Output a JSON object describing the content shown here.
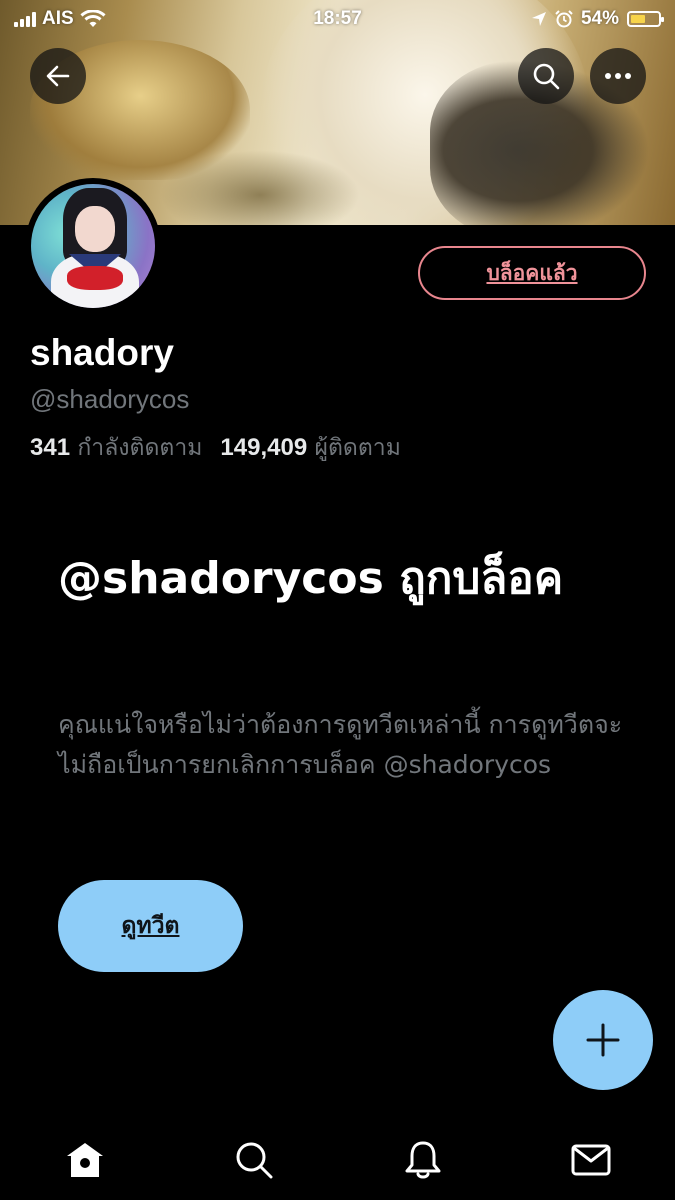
{
  "status_bar": {
    "carrier": "AIS",
    "time": "18:57",
    "battery_percent": "54%",
    "battery_level": 0.54,
    "icons": [
      "signal-icon",
      "wifi-icon",
      "location-icon",
      "alarm-icon",
      "battery-icon"
    ]
  },
  "header": {
    "back_icon": "back-arrow-icon",
    "search_icon": "search-icon",
    "more_icon": "more-icon"
  },
  "profile": {
    "display_name": "shadory",
    "handle": "@shadorycos",
    "following_count": "341",
    "following_label": "กำลังติดตาม",
    "followers_count": "149,409",
    "followers_label": "ผู้ติดตาม",
    "blocked_button_label": "บล็อคแล้ว"
  },
  "blocked_notice": {
    "title": "@shadorycos ถูกบล็อค",
    "description": "คุณแน่ใจหรือไม่ว่าต้องการดูทวีตเหล่านี้ การดูทวีตจะไม่ถือเป็นการยกเลิกการบล็อค @shadorycos",
    "view_button_label": "ดูทวีต"
  },
  "fab": {
    "icon": "plus-icon"
  },
  "tabbar": {
    "items": [
      {
        "name": "home",
        "icon": "home-icon"
      },
      {
        "name": "search",
        "icon": "search-icon"
      },
      {
        "name": "notifications",
        "icon": "bell-icon"
      },
      {
        "name": "messages",
        "icon": "mail-icon"
      }
    ]
  },
  "colors": {
    "background": "#000000",
    "accent": "#8ecdf8",
    "blocked_red": "#f0939a",
    "secondary_text": "#71767b"
  }
}
